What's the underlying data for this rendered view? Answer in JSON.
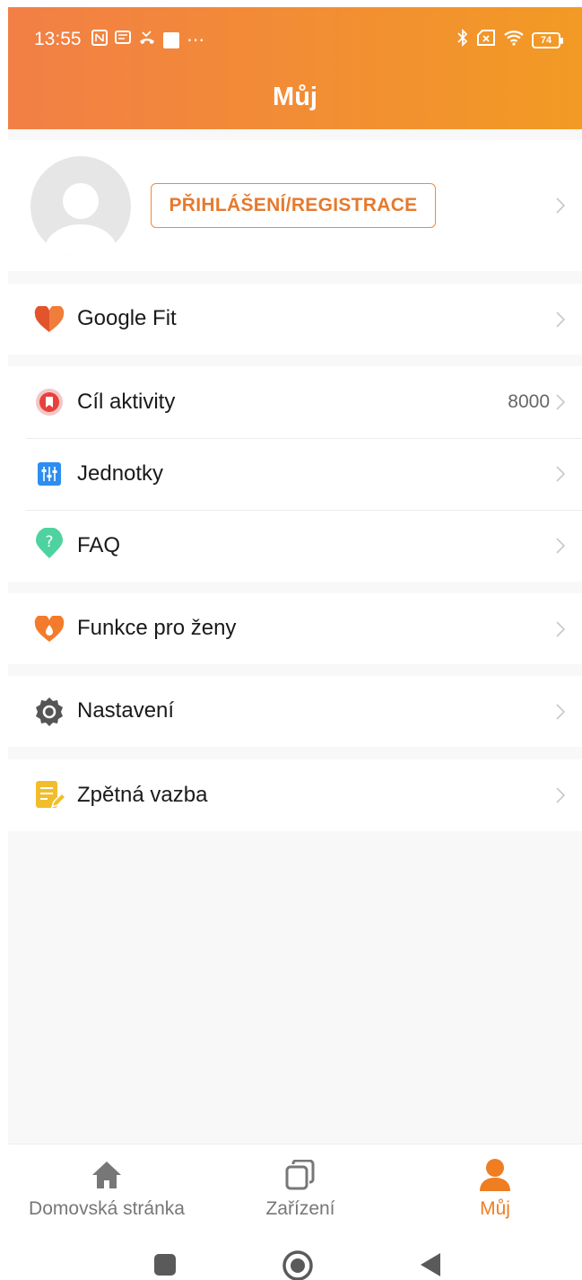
{
  "status_bar": {
    "time": "13:55",
    "battery_level": "74",
    "icons_left": [
      "nfc-icon",
      "message-icon",
      "missed-call-icon",
      "notification-icon",
      "more-icon"
    ],
    "icons_right": [
      "bluetooth-icon",
      "no-sim-icon",
      "wifi-icon",
      "battery-icon"
    ]
  },
  "header": {
    "title": "Můj"
  },
  "profile": {
    "login_label": "PŘIHLÁŠENÍ/REGISTRACE"
  },
  "menu": {
    "google_fit": {
      "label": "Google Fit",
      "icon": "heart-icon"
    },
    "activity_goal": {
      "label": "Cíl aktivity",
      "value": "8000",
      "icon": "goal-icon"
    },
    "units": {
      "label": "Jednotky",
      "icon": "sliders-icon"
    },
    "faq": {
      "label": "FAQ",
      "icon": "question-icon"
    },
    "women": {
      "label": "Funkce pro ženy",
      "icon": "women-health-icon"
    },
    "settings": {
      "label": "Nastavení",
      "icon": "gear-icon"
    },
    "feedback": {
      "label": "Zpětná vazba",
      "icon": "feedback-icon"
    }
  },
  "bottom_nav": {
    "home": "Domovská stránka",
    "devices": "Zařízení",
    "mine": "Můj"
  },
  "colors": {
    "header_start": "#f27f46",
    "header_end": "#f29a24",
    "accent": "#ef7d22",
    "background": "#f8f8f8"
  }
}
